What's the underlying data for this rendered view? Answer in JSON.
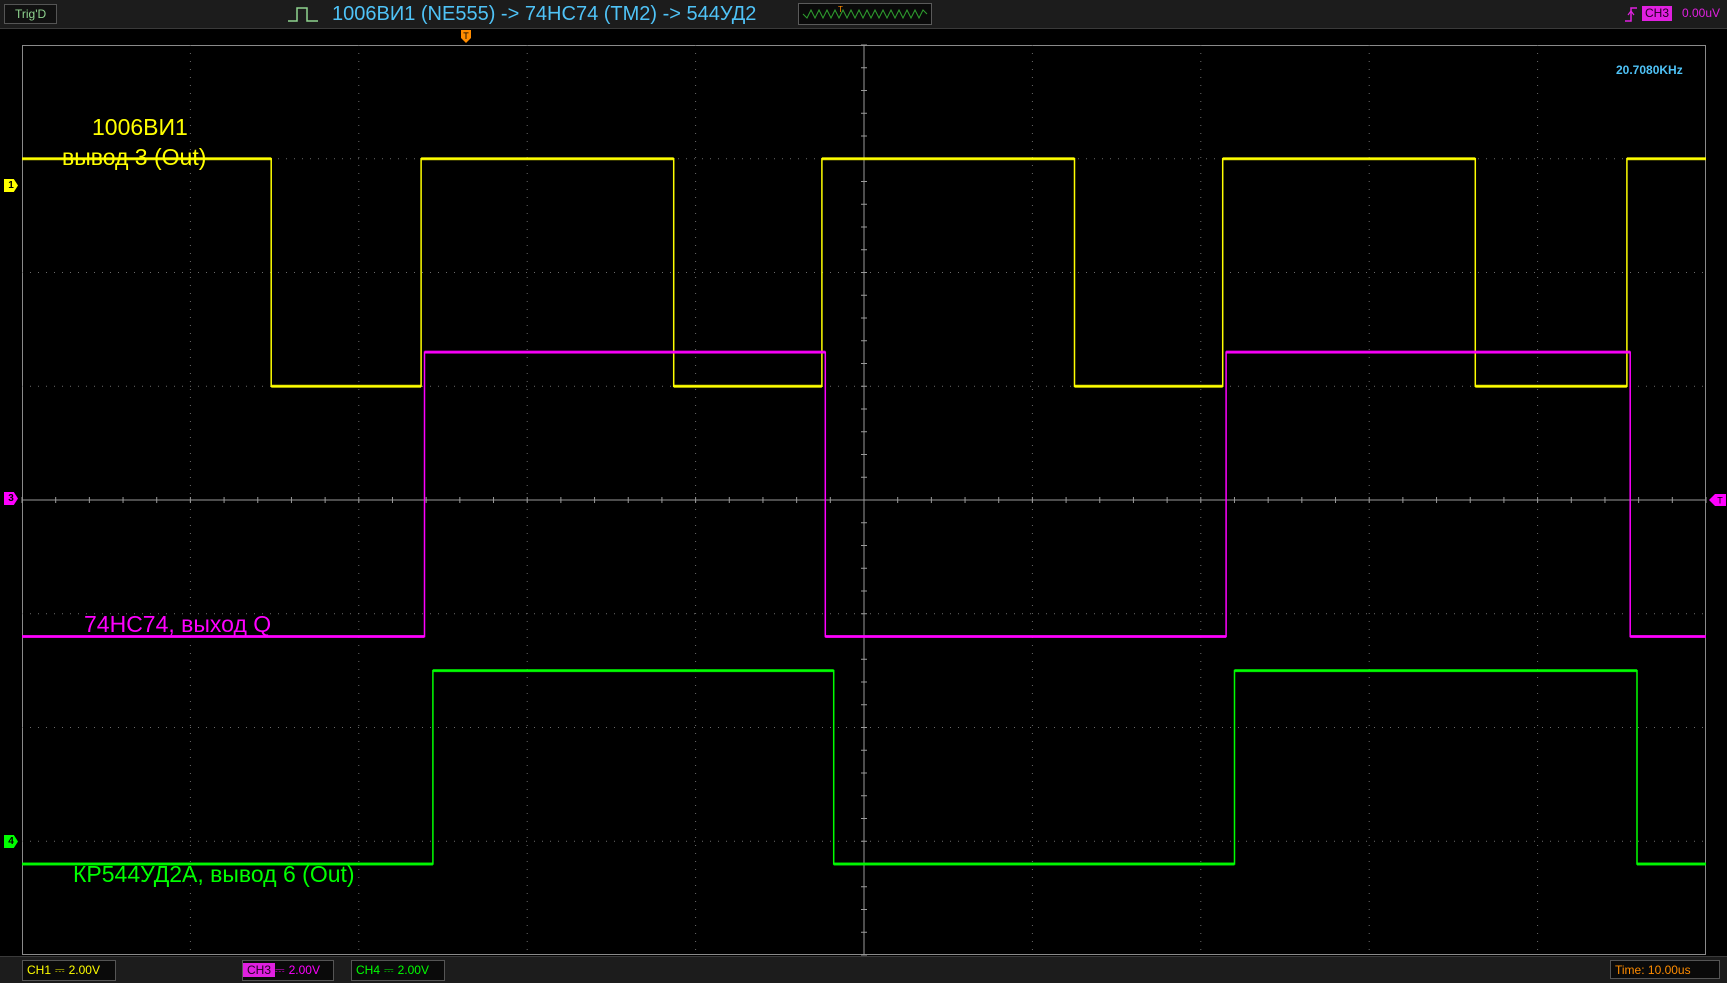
{
  "header": {
    "trigger_mode": "Trig'D",
    "title": "1006ВИ1 (NE555) -> 74HC74 (TM2) -> 544УД2",
    "trigger_channel": "CH3",
    "trigger_level": "0.00uV",
    "trigger_position_marker": "T",
    "pulse_icon": "single-pulse-icon",
    "trigger_edge_icon": "rising-edge-icon"
  },
  "measurement": {
    "frequency": "20.7080KHz"
  },
  "channels": [
    {
      "id": "CH1",
      "marker": "1",
      "color": "#ffff00",
      "label_line1": "1006ВИ1",
      "label_line2": "вывод 3 (Out)",
      "volts_div": "2.00V",
      "coupling_icon": "dc-coupling-icon"
    },
    {
      "id": "CH3",
      "marker": "3",
      "color": "#ff00ff",
      "label_line1": "74HC74, выход Q",
      "volts_div": "2.00V",
      "coupling_icon": "dc-coupling-icon"
    },
    {
      "id": "CH4",
      "marker": "4",
      "color": "#00ff00",
      "label_line1": "КР544УД2А, вывод 6 (Out)",
      "volts_div": "2.00V",
      "coupling_icon": "dc-coupling-icon"
    }
  ],
  "footer": {
    "time_div": "Time: 10.00us",
    "coupling_symbol": "⎓"
  },
  "chart_data": {
    "type": "line",
    "xlabel": "",
    "ylabel": "",
    "x_unit": "us",
    "x_range": [
      -50,
      50
    ],
    "y_unit": "div",
    "y_range": [
      -4,
      4
    ],
    "grid": true,
    "series": [
      {
        "name": "1006ВИ1 вывод 3 (Out)",
        "color": "#ffff00",
        "x": [
          -50,
          -35.2,
          -35.2,
          -26.3,
          -26.3,
          -11.3,
          -11.3,
          -2.5,
          -2.5,
          12.5,
          12.5,
          21.3,
          21.3,
          36.3,
          36.3,
          45.3,
          45.3,
          50
        ],
        "y": [
          3.0,
          3.0,
          1.0,
          1.0,
          3.0,
          3.0,
          1.0,
          1.0,
          3.0,
          3.0,
          1.0,
          1.0,
          3.0,
          3.0,
          1.0,
          1.0,
          3.0,
          3.0
        ]
      },
      {
        "name": "74HC74, выход Q",
        "color": "#ff00ff",
        "x": [
          -50,
          -26.1,
          -26.1,
          -2.3,
          -2.3,
          21.5,
          21.5,
          45.5,
          45.5,
          50
        ],
        "y": [
          -1.2,
          -1.2,
          1.3,
          1.3,
          -1.2,
          -1.2,
          1.3,
          1.3,
          -1.2,
          -1.2
        ]
      },
      {
        "name": "КР544УД2А, вывод 6 (Out)",
        "color": "#00ff00",
        "x": [
          -50,
          -25.6,
          -25.6,
          -1.8,
          -1.8,
          22.0,
          22.0,
          45.9,
          45.9,
          50
        ],
        "y": [
          -3.2,
          -3.2,
          -1.5,
          -1.5,
          -3.2,
          -3.2,
          -1.5,
          -1.5,
          -3.2,
          -3.2
        ]
      }
    ]
  }
}
